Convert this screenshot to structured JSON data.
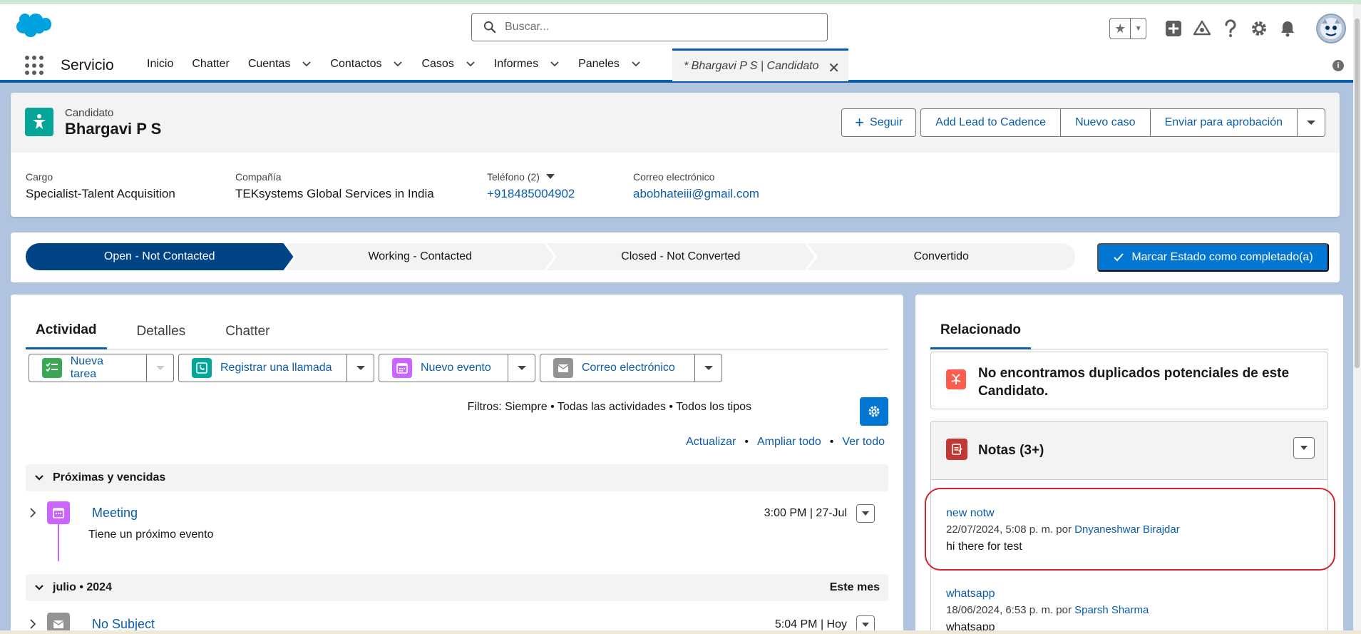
{
  "search": {
    "placeholder": "Buscar..."
  },
  "nav": {
    "app_name": "Servicio",
    "items": [
      {
        "label": "Inicio",
        "has_menu": false
      },
      {
        "label": "Chatter",
        "has_menu": false
      },
      {
        "label": "Cuentas",
        "has_menu": true
      },
      {
        "label": "Contactos",
        "has_menu": true
      },
      {
        "label": "Casos",
        "has_menu": true
      },
      {
        "label": "Informes",
        "has_menu": true
      },
      {
        "label": "Paneles",
        "has_menu": true
      }
    ],
    "active_tab": "* Bhargavi P S | Candidato",
    "close_glyph": "✕"
  },
  "record": {
    "type": "Candidato",
    "name": "Bhargavi P S",
    "actions": {
      "follow": "Seguir",
      "add_lead": "Add Lead to Cadence",
      "new_case": "Nuevo caso",
      "approval": "Enviar para aprobación"
    },
    "fields": {
      "cargo_label": "Cargo",
      "cargo_value": "Specialist-Talent Acquisition",
      "company_label": "Compañía",
      "company_value": "TEKsystems Global Services in India",
      "phone_label": "Teléfono (2)",
      "phone_value": "+918485004902",
      "email_label": "Correo electrónico",
      "email_value": "abobhateiii@gmail.com"
    }
  },
  "path": {
    "steps": [
      "Open - Not Contacted",
      "Working - Contacted",
      "Closed - Not Converted",
      "Convertido"
    ],
    "active_index": 0,
    "complete_label": "Marcar Estado como completado(a)"
  },
  "activity": {
    "tabs": [
      "Actividad",
      "Detalles",
      "Chatter"
    ],
    "publishers": {
      "task": "Nueva tarea",
      "call": "Registrar una llamada",
      "event": "Nuevo evento",
      "email": "Correo electrónico"
    },
    "filters": "Filtros: Siempre • Todas las actividades • Todos los tipos",
    "links": {
      "refresh": "Actualizar",
      "expand": "Ampliar todo",
      "view_all": "Ver todo",
      "separator": "•"
    },
    "upcoming_section": "Próximas y vencidas",
    "meeting": {
      "title": "Meeting",
      "time": "3:00 PM | 27-Jul",
      "subtitle": "Tiene un próximo evento"
    },
    "month_section": "julio • 2024",
    "month_section_right": "Este mes",
    "email_item": {
      "title": "No Subject",
      "time": "5:04 PM | Hoy"
    }
  },
  "related": {
    "tab": "Relacionado",
    "duplicates": "No encontramos duplicados potenciales de este Candidato.",
    "notes_title": "Notas (3+)",
    "notes": [
      {
        "title": "new notw",
        "meta_prefix": "22/07/2024, 5:08 p. m. por",
        "author": "Dnyaneshwar Birajdar",
        "body": "hi there for test"
      },
      {
        "title": "whatsapp",
        "meta_prefix": "18/06/2024, 6:53 p. m. por",
        "author": "Sparsh Sharma",
        "body": "whatsapp"
      }
    ]
  },
  "colors": {
    "brand_blue": "#0176d3",
    "active_path": "#014486",
    "link": "#0b5cab",
    "candidate_icon": "#06a59a",
    "highlight_ring": "#d8212f"
  }
}
